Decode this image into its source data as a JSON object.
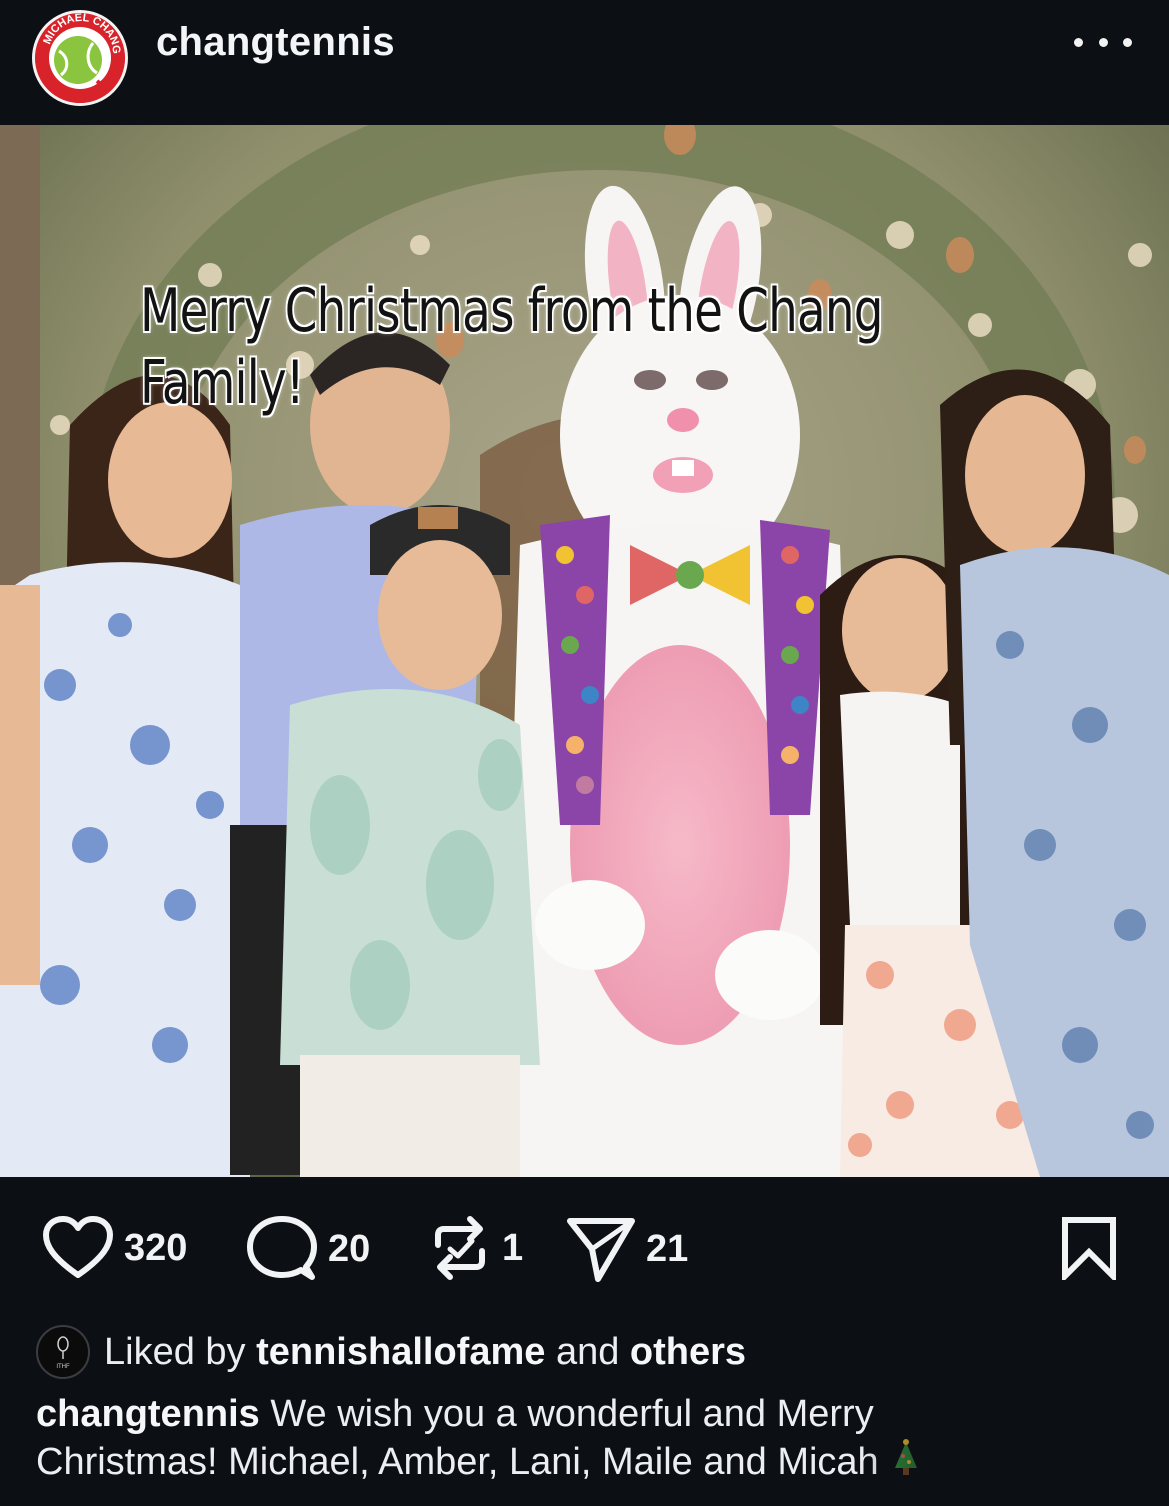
{
  "header": {
    "username": "changtennis",
    "avatar_logo_text": "MICHAEL CHANG",
    "more_icon": "more-horizontal-icon"
  },
  "photo": {
    "overlay_text": "Merry Christmas from the Chang\nFamily!"
  },
  "actions": {
    "likes": "320",
    "comments": "20",
    "reposts": "1",
    "shares": "21",
    "icons": [
      "heart-icon",
      "comment-icon",
      "repost-icon",
      "send-icon",
      "bookmark-icon"
    ]
  },
  "likes_line": {
    "prefix": "Liked by ",
    "user": "tennishallofame",
    "middle": " and ",
    "suffix": "others",
    "liker_avatar_text": "ITHF"
  },
  "caption": {
    "username": "changtennis",
    "text": " We wish you a wonderful and Merry\nChristmas! Michael, Amber, Lani, Maile and Micah"
  },
  "colors": {
    "background": "#0c0f14",
    "text": "#f2f3f5",
    "avatar_red": "#d8232a",
    "tennis_ball": "#8bc53f"
  }
}
